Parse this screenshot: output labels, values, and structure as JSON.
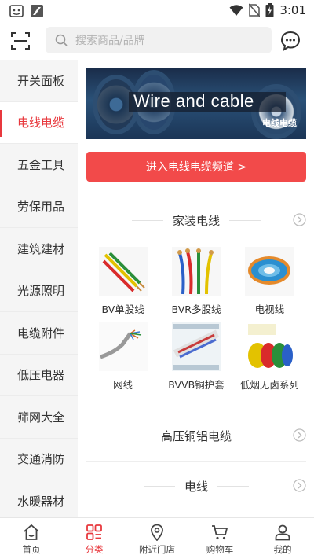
{
  "status_bar": {
    "time": "3:01"
  },
  "search": {
    "placeholder": "搜索商品/品牌"
  },
  "sidebar": {
    "items": [
      {
        "label": "开关面板",
        "active": false
      },
      {
        "label": "电线电缆",
        "active": true
      },
      {
        "label": "五金工具",
        "active": false
      },
      {
        "label": "劳保用品",
        "active": false
      },
      {
        "label": "建筑建材",
        "active": false
      },
      {
        "label": "光源照明",
        "active": false
      },
      {
        "label": "电缆附件",
        "active": false
      },
      {
        "label": "低压电器",
        "active": false
      },
      {
        "label": "筛网大全",
        "active": false
      },
      {
        "label": "交通消防",
        "active": false
      },
      {
        "label": "水暖器材",
        "active": false
      }
    ]
  },
  "banner": {
    "title": "Wire and cable",
    "subtitle": "电线电缆"
  },
  "enter_button": {
    "label": "进入电线电缆频道 >"
  },
  "sections": [
    {
      "title": "家装电线",
      "products": [
        {
          "label": "BV单股线"
        },
        {
          "label": "BVR多股线"
        },
        {
          "label": "电视线"
        },
        {
          "label": "网线"
        },
        {
          "label": "BVVB铜护套"
        },
        {
          "label": "低烟无卤系列"
        }
      ]
    },
    {
      "title": "高压铜铝电缆"
    },
    {
      "title": "电线"
    }
  ],
  "tabbar": {
    "tabs": [
      {
        "label": "首页",
        "icon": "home-icon"
      },
      {
        "label": "分类",
        "icon": "category-icon",
        "active": true
      },
      {
        "label": "附近门店",
        "icon": "location-icon"
      },
      {
        "label": "购物车",
        "icon": "cart-icon"
      },
      {
        "label": "我的",
        "icon": "user-icon"
      }
    ]
  },
  "colors": {
    "accent": "#e8383d",
    "button": "#f24a4a"
  }
}
